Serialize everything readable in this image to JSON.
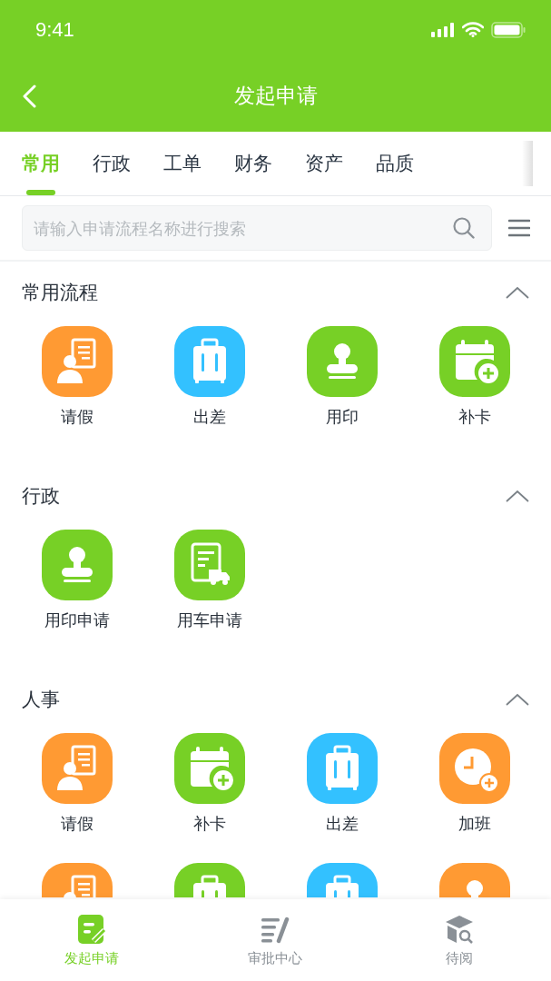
{
  "status_bar": {
    "time": "9:41"
  },
  "nav": {
    "title": "发起申请"
  },
  "tabs": [
    {
      "label": "常用",
      "selected": true
    },
    {
      "label": "行政",
      "selected": false
    },
    {
      "label": "工单",
      "selected": false
    },
    {
      "label": "财务",
      "selected": false
    },
    {
      "label": "资产",
      "selected": false
    },
    {
      "label": "品质",
      "selected": false
    }
  ],
  "search": {
    "placeholder": "请输入申请流程名称进行搜索"
  },
  "sections": [
    {
      "title": "常用流程",
      "expanded": true,
      "items": [
        {
          "label": "请假",
          "kind": "leave",
          "color": "#ff9a33"
        },
        {
          "label": "出差",
          "kind": "trip",
          "color": "#33c1ff"
        },
        {
          "label": "用印",
          "kind": "seal",
          "color": "#77d026"
        },
        {
          "label": "补卡",
          "kind": "clockin",
          "color": "#77d026"
        }
      ]
    },
    {
      "title": "行政",
      "expanded": true,
      "items": [
        {
          "label": "用印申请",
          "kind": "seal",
          "color": "#77d026"
        },
        {
          "label": "用车申请",
          "kind": "car",
          "color": "#77d026"
        }
      ]
    },
    {
      "title": "人事",
      "expanded": true,
      "items": [
        {
          "label": "请假",
          "kind": "leave",
          "color": "#ff9a33"
        },
        {
          "label": "补卡",
          "kind": "clockin",
          "color": "#77d026"
        },
        {
          "label": "出差",
          "kind": "trip",
          "color": "#33c1ff"
        },
        {
          "label": "加班",
          "kind": "overtime",
          "color": "#ff9a33"
        },
        {
          "kind": "doc",
          "color": "#ff9a33"
        },
        {
          "kind": "trip",
          "color": "#77d026"
        },
        {
          "kind": "trip",
          "color": "#33c1ff"
        },
        {
          "kind": "seal",
          "color": "#ff9a33"
        }
      ]
    }
  ],
  "bottom_tabs": [
    {
      "label": "发起申请",
      "kind": "apply",
      "selected": true
    },
    {
      "label": "审批中心",
      "kind": "approve",
      "selected": false
    },
    {
      "label": "待阅",
      "kind": "read",
      "selected": false
    }
  ]
}
